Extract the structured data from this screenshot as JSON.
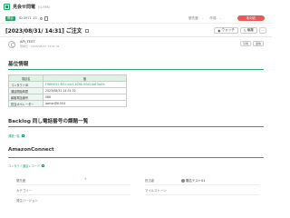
{
  "app": {
    "title": "見会せ問電",
    "title_en": "(Q-RPA)"
  },
  "record": {
    "badge": "問合",
    "id": "ID:3971 13",
    "meta": [
      {
        "label": "優先度:",
        "value": "-"
      },
      {
        "label": "作成:",
        "value": "-"
      }
    ],
    "status": "未対応"
  },
  "page": {
    "title": "[2023/08/31/ 14:31] ご注文"
  },
  "toolbar": {
    "watch_label": "ウォッチ",
    "edit_label": "編集",
    "more_label": "⋯"
  },
  "comment": {
    "user": "API_TEST",
    "date": "登録日 : 2023/08/31 14:31:31",
    "buttons": [
      "引用",
      "返信"
    ]
  },
  "sections": {
    "basic": {
      "heading": "基位情報",
      "table": {
        "headers": [
          "項目名",
          "値"
        ],
        "rows": [
          {
            "key": "コンタクトID",
            "value": "f7869092-8f1f-44c3-b298-93d51b67bd5c",
            "is_link": true
          },
          {
            "key": "通話開始時間",
            "value": "2023/08/31 14:31:32",
            "is_link": false
          },
          {
            "key": "顧客電話番号",
            "value": "086",
            "is_link": false
          },
          {
            "key": "担当オペレーター",
            "value": "owner@tl.004",
            "is_link": false
          }
        ]
      }
    },
    "backlog": {
      "heading": "Backlog 同し電話番号の課題一覧",
      "link": "課題一覧"
    },
    "amazon": {
      "heading": "AmazonConnect",
      "link": "コンタクト通話レコード",
      "fields": [
        {
          "label": "優先度",
          "value": "+"
        },
        {
          "label": "カテゴリー",
          "value": ""
        },
        {
          "label": "発生バージョン",
          "value": ""
        },
        {
          "label": "担当者",
          "value": "楓名テスト01"
        },
        {
          "label": "マイルストーン",
          "value": ""
        }
      ]
    }
  }
}
